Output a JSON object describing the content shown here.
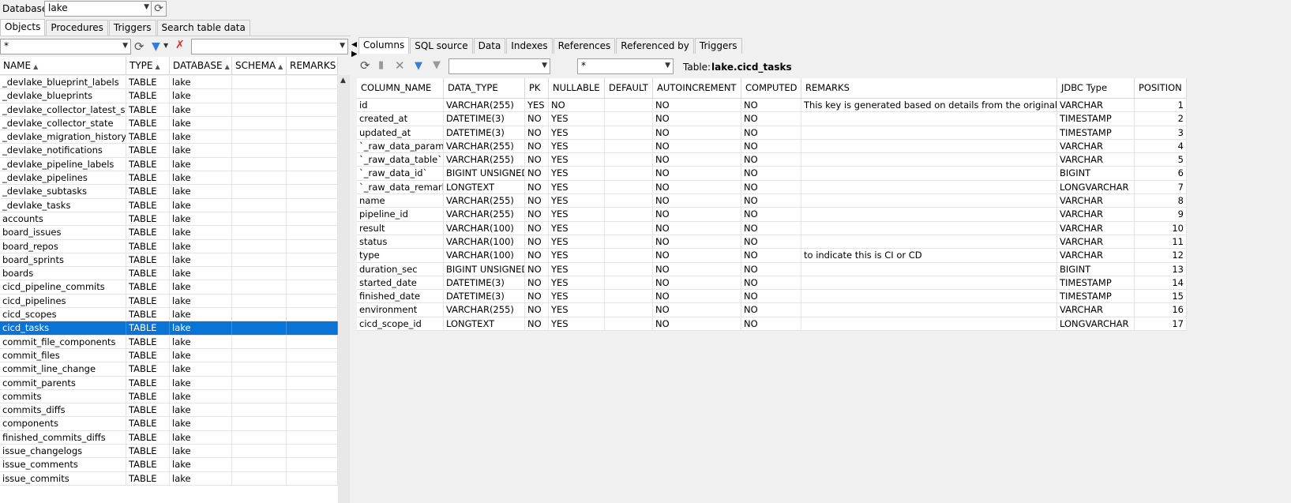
{
  "top": {
    "database_label": "Database",
    "database_value": "lake"
  },
  "left_tabs": [
    "Objects",
    "Procedures",
    "Triggers",
    "Search table data"
  ],
  "left_filter": {
    "schema_value": "*",
    "search_value": ""
  },
  "objects_table": {
    "headers": [
      "NAME",
      "TYPE",
      "DATABASE",
      "SCHEMA",
      "REMARKS"
    ],
    "rows": [
      [
        "_devlake_blueprint_labels",
        "TABLE",
        "lake",
        "",
        ""
      ],
      [
        "_devlake_blueprints",
        "TABLE",
        "lake",
        "",
        ""
      ],
      [
        "_devlake_collector_latest_state",
        "TABLE",
        "lake",
        "",
        ""
      ],
      [
        "_devlake_collector_state",
        "TABLE",
        "lake",
        "",
        ""
      ],
      [
        "_devlake_migration_history",
        "TABLE",
        "lake",
        "",
        ""
      ],
      [
        "_devlake_notifications",
        "TABLE",
        "lake",
        "",
        ""
      ],
      [
        "_devlake_pipeline_labels",
        "TABLE",
        "lake",
        "",
        ""
      ],
      [
        "_devlake_pipelines",
        "TABLE",
        "lake",
        "",
        ""
      ],
      [
        "_devlake_subtasks",
        "TABLE",
        "lake",
        "",
        ""
      ],
      [
        "_devlake_tasks",
        "TABLE",
        "lake",
        "",
        ""
      ],
      [
        "accounts",
        "TABLE",
        "lake",
        "",
        ""
      ],
      [
        "board_issues",
        "TABLE",
        "lake",
        "",
        ""
      ],
      [
        "board_repos",
        "TABLE",
        "lake",
        "",
        ""
      ],
      [
        "board_sprints",
        "TABLE",
        "lake",
        "",
        ""
      ],
      [
        "boards",
        "TABLE",
        "lake",
        "",
        ""
      ],
      [
        "cicd_pipeline_commits",
        "TABLE",
        "lake",
        "",
        ""
      ],
      [
        "cicd_pipelines",
        "TABLE",
        "lake",
        "",
        ""
      ],
      [
        "cicd_scopes",
        "TABLE",
        "lake",
        "",
        ""
      ],
      [
        "cicd_tasks",
        "TABLE",
        "lake",
        "",
        ""
      ],
      [
        "commit_file_components",
        "TABLE",
        "lake",
        "",
        ""
      ],
      [
        "commit_files",
        "TABLE",
        "lake",
        "",
        ""
      ],
      [
        "commit_line_change",
        "TABLE",
        "lake",
        "",
        ""
      ],
      [
        "commit_parents",
        "TABLE",
        "lake",
        "",
        ""
      ],
      [
        "commits",
        "TABLE",
        "lake",
        "",
        ""
      ],
      [
        "commits_diffs",
        "TABLE",
        "lake",
        "",
        ""
      ],
      [
        "components",
        "TABLE",
        "lake",
        "",
        ""
      ],
      [
        "finished_commits_diffs",
        "TABLE",
        "lake",
        "",
        ""
      ],
      [
        "issue_changelogs",
        "TABLE",
        "lake",
        "",
        ""
      ],
      [
        "issue_comments",
        "TABLE",
        "lake",
        "",
        ""
      ],
      [
        "issue_commits",
        "TABLE",
        "lake",
        "",
        ""
      ]
    ],
    "selected_index": 18
  },
  "right_tabs": [
    "Columns",
    "SQL source",
    "Data",
    "Indexes",
    "References",
    "Referenced by",
    "Triggers"
  ],
  "right_toolbar": {
    "filter_value": "",
    "pattern_value": "*",
    "table_label": "Table:",
    "table_name": "lake.cicd_tasks"
  },
  "columns_table": {
    "headers": [
      "COLUMN_NAME",
      "DATA_TYPE",
      "PK",
      "NULLABLE",
      "DEFAULT",
      "AUTOINCREMENT",
      "COMPUTED",
      "REMARKS",
      "JDBC Type",
      "POSITION"
    ],
    "rows": [
      [
        "id",
        "VARCHAR(255)",
        "YES",
        "NO",
        "",
        "NO",
        "NO",
        "This key is generated based on details from the original plugin",
        "VARCHAR",
        "1"
      ],
      [
        "created_at",
        "DATETIME(3)",
        "NO",
        "YES",
        "",
        "NO",
        "NO",
        "",
        "TIMESTAMP",
        "2"
      ],
      [
        "updated_at",
        "DATETIME(3)",
        "NO",
        "YES",
        "",
        "NO",
        "NO",
        "",
        "TIMESTAMP",
        "3"
      ],
      [
        "`_raw_data_params`",
        "VARCHAR(255)",
        "NO",
        "YES",
        "",
        "NO",
        "NO",
        "",
        "VARCHAR",
        "4"
      ],
      [
        "`_raw_data_table`",
        "VARCHAR(255)",
        "NO",
        "YES",
        "",
        "NO",
        "NO",
        "",
        "VARCHAR",
        "5"
      ],
      [
        "`_raw_data_id`",
        "BIGINT UNSIGNED",
        "NO",
        "YES",
        "",
        "NO",
        "NO",
        "",
        "BIGINT",
        "6"
      ],
      [
        "`_raw_data_remark`",
        "LONGTEXT",
        "NO",
        "YES",
        "",
        "NO",
        "NO",
        "",
        "LONGVARCHAR",
        "7"
      ],
      [
        "name",
        "VARCHAR(255)",
        "NO",
        "YES",
        "",
        "NO",
        "NO",
        "",
        "VARCHAR",
        "8"
      ],
      [
        "pipeline_id",
        "VARCHAR(255)",
        "NO",
        "YES",
        "",
        "NO",
        "NO",
        "",
        "VARCHAR",
        "9"
      ],
      [
        "result",
        "VARCHAR(100)",
        "NO",
        "YES",
        "",
        "NO",
        "NO",
        "",
        "VARCHAR",
        "10"
      ],
      [
        "status",
        "VARCHAR(100)",
        "NO",
        "YES",
        "",
        "NO",
        "NO",
        "",
        "VARCHAR",
        "11"
      ],
      [
        "type",
        "VARCHAR(100)",
        "NO",
        "YES",
        "",
        "NO",
        "NO",
        "to indicate this is CI or CD",
        "VARCHAR",
        "12"
      ],
      [
        "duration_sec",
        "BIGINT UNSIGNED",
        "NO",
        "YES",
        "",
        "NO",
        "NO",
        "",
        "BIGINT",
        "13"
      ],
      [
        "started_date",
        "DATETIME(3)",
        "NO",
        "YES",
        "",
        "NO",
        "NO",
        "",
        "TIMESTAMP",
        "14"
      ],
      [
        "finished_date",
        "DATETIME(3)",
        "NO",
        "YES",
        "",
        "NO",
        "NO",
        "",
        "TIMESTAMP",
        "15"
      ],
      [
        "environment",
        "VARCHAR(255)",
        "NO",
        "YES",
        "",
        "NO",
        "NO",
        "",
        "VARCHAR",
        "16"
      ],
      [
        "cicd_scope_id",
        "LONGTEXT",
        "NO",
        "YES",
        "",
        "NO",
        "NO",
        "",
        "LONGVARCHAR",
        "17"
      ]
    ]
  },
  "colors": {
    "selection": "#0a73d6",
    "filter_icon": "#3a7bd5",
    "clear_filter_icon": "#d32f2f"
  }
}
